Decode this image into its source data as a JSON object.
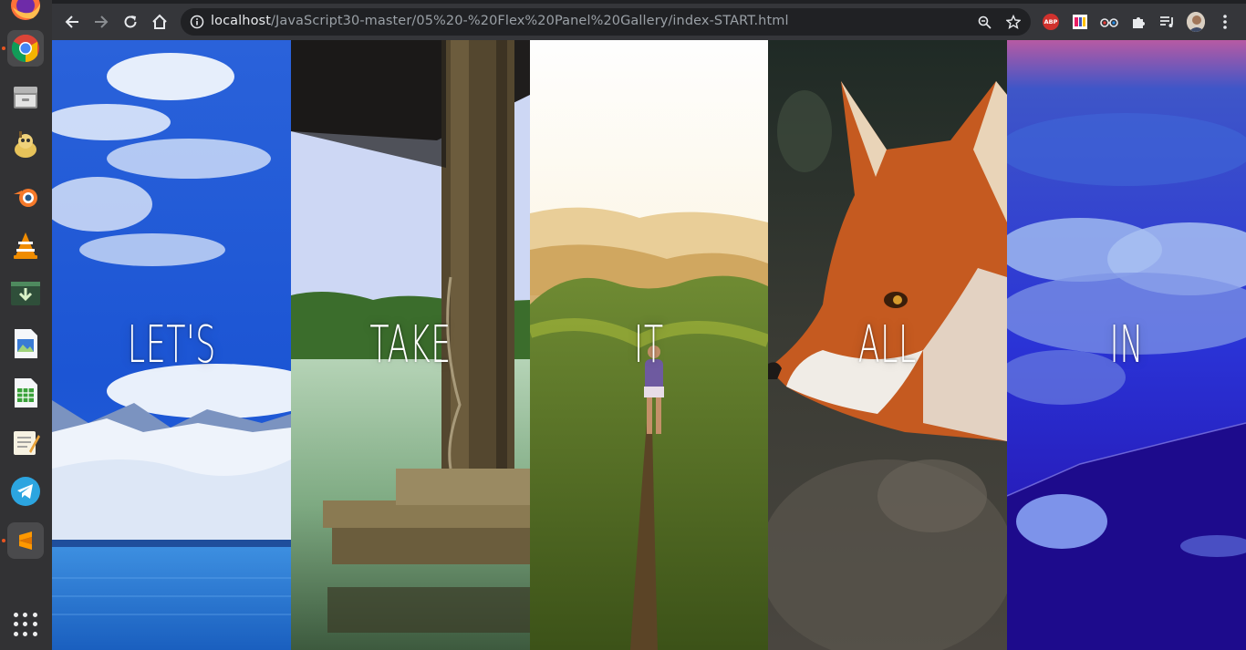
{
  "dock": {
    "items": [
      {
        "name": "firefox-icon"
      },
      {
        "name": "chrome-icon"
      },
      {
        "name": "file-manager-icon"
      },
      {
        "name": "gimp-icon"
      },
      {
        "name": "blender-icon"
      },
      {
        "name": "vlc-icon"
      },
      {
        "name": "terminal-download-icon"
      },
      {
        "name": "document-viewer-icon"
      },
      {
        "name": "spreadsheet-icon"
      },
      {
        "name": "text-editor-icon"
      },
      {
        "name": "telegram-icon"
      },
      {
        "name": "sublime-text-icon"
      }
    ],
    "show_apps": "show-applications-icon"
  },
  "browser": {
    "url_host": "localhost",
    "url_path": "/JavaScript30-master/05%20-%20Flex%20Panel%20Gallery/index-START.html",
    "extensions": {
      "adblock_label": "ABP"
    }
  },
  "gallery": {
    "panels": [
      {
        "word": "LET'S"
      },
      {
        "word": "TAKE"
      },
      {
        "word": "IT"
      },
      {
        "word": "ALL"
      },
      {
        "word": "IN"
      }
    ]
  },
  "colors": {
    "panel_1_sky": "#1e58d6",
    "panel_2_sky": "#c9d4f4",
    "panel_3_sky": "#fff6dc",
    "panel_4_fox": "#c2541d",
    "panel_5_sky": "#2a2bd9",
    "dock_bg": "#323234",
    "toolbar_bg": "#35363a"
  }
}
